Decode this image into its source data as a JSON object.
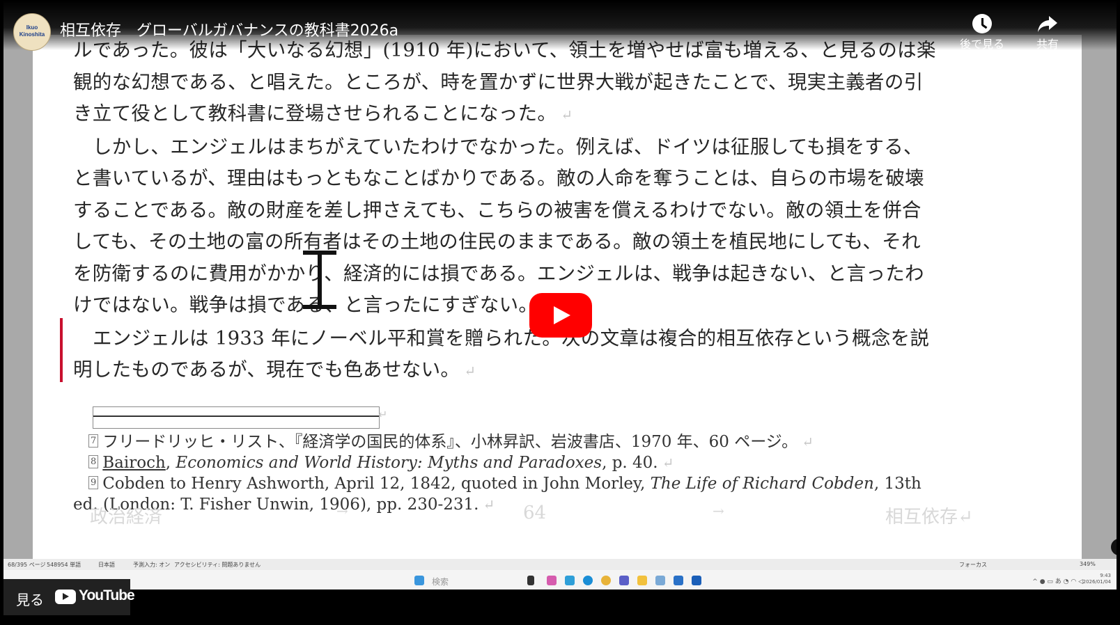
{
  "header": {
    "title": "相互依存　グローバルガバナンスの教科書2026a",
    "channel_avatar_lines": [
      "Ikuo",
      "Kinoshita"
    ],
    "watch_later_label": "後で見る",
    "share_label": "共有"
  },
  "document": {
    "paragraphs": [
      {
        "lines": [
          "ルであった。彼は「大いなる幻想」(1910 年)において、領土を増やせば富も増える、と見るのは楽",
          "観的な幻想である、と唱えた。ところが、時を置かずに世界大戦が起きたことで、現実主義者の引",
          "き立て役として教科書に登場させられることになった。"
        ],
        "pilcrow": "↵"
      },
      {
        "lines": [
          "しかし、エンジェルはまちがえていたわけでなかった。例えば、ドイツは征服しても損をする、",
          "と書いているが、理由はもっともなことばかりである。敵の人命を奪うことは、自らの市場を破壊",
          "することである。敵の財産を差し押さえても、こちらの被害を償えるわけでない。敵の領土を併合",
          "しても、その土地の富の所有者はその土地の住民のままである。敵の領土を植民地にしても、それ",
          "を防衛するのに費用がかかり、経済的には損である。エンジェルは、戦争は起きない、と言ったわ",
          "けではない。戦争は損である、と言ったにすぎない。"
        ],
        "pilcrow": "↵"
      },
      {
        "lines": [
          "エンジェルは 1933 年にノーベル平和賞を贈られた。次の文章は複合的相互依存という概念を説",
          "明したものであるが、現在でも色あせない。"
        ],
        "pilcrow": "↵"
      }
    ],
    "footnotes": [
      {
        "num": "7",
        "text": "フリードリッヒ・リスト、『経済学の国民的体系』、小林昇訳、岩波書店、1970 年、60 ページ。"
      },
      {
        "num": "8",
        "author": "Bairoch",
        "title": "Economics and World History: Myths and Paradoxes",
        "rest": ", p. 40."
      },
      {
        "num": "9",
        "pre": "Cobden to Henry Ashworth, April 12, 1842, quoted in John Morley, ",
        "title": "The Life of Richard Cobden",
        "rest": ", 13th",
        "continuation": "ed. (London: T. Fisher Unwin, 1906), pp. 230-231."
      }
    ],
    "footer": {
      "left": "政治経済",
      "center": "64",
      "right": "相互依存↵",
      "tab_mark": "→"
    }
  },
  "status_bar": {
    "pages": "68/395 ページ",
    "words": "548954 単語",
    "language": "日本語",
    "predict": "予測入力: オン",
    "accessibility": "アクセシビリティ: 問題ありません",
    "focus": "フォーカス",
    "zoom": "349%"
  },
  "taskbar": {
    "search_placeholder": "検索",
    "clock": [
      "9:43",
      "2026/01/04"
    ]
  },
  "watch_bar": {
    "label": "見る",
    "brand": "YouTube"
  },
  "colors": {
    "play_button": "#ff0000",
    "change_bar": "#c8102e"
  }
}
